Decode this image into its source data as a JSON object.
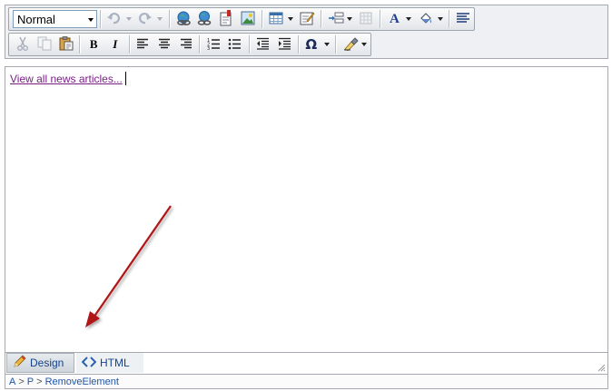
{
  "toolbar": {
    "format_select": {
      "value": "Normal"
    },
    "row1": [
      {
        "icon": "undo-icon",
        "state": "disabled",
        "split": true
      },
      {
        "icon": "redo-icon",
        "state": "disabled",
        "split": true
      },
      {
        "icon": "hyperlink-manager-icon"
      },
      {
        "icon": "remove-link-icon"
      },
      {
        "icon": "document-manager-icon"
      },
      {
        "icon": "image-manager-icon"
      },
      {
        "icon": "insert-table-icon",
        "split": true
      },
      {
        "icon": "edit-properties-icon"
      },
      {
        "icon": "insert-form-element-icon",
        "split": true
      },
      {
        "icon": "table-grid-icon",
        "state": "disabled"
      },
      {
        "icon": "foreground-color-icon",
        "split": true
      },
      {
        "icon": "background-color-icon",
        "split": true
      },
      {
        "icon": "paragraph-align-icon"
      }
    ],
    "row2": [
      {
        "icon": "cut-icon",
        "state": "disabled"
      },
      {
        "icon": "copy-icon",
        "state": "disabled"
      },
      {
        "icon": "paste-icon"
      },
      {
        "icon": "bold-icon",
        "glyph": "B"
      },
      {
        "icon": "italic-icon",
        "glyph": "I"
      },
      {
        "icon": "align-left-icon"
      },
      {
        "icon": "align-center-icon"
      },
      {
        "icon": "align-right-icon"
      },
      {
        "icon": "numbered-list-icon"
      },
      {
        "icon": "bulleted-list-icon"
      },
      {
        "icon": "outdent-icon"
      },
      {
        "icon": "indent-icon"
      },
      {
        "icon": "special-characters-icon",
        "glyph": "Ω",
        "split": true
      },
      {
        "icon": "format-stripper-icon",
        "split": true
      }
    ]
  },
  "content": {
    "link_text": "View all news articles..."
  },
  "modes": {
    "design_label": "Design",
    "html_label": "HTML",
    "active": "Design"
  },
  "status_bar": {
    "path": [
      "A",
      "P",
      "RemoveElement"
    ]
  },
  "colors": {
    "link": "#7a1f86",
    "annotation_arrow": "#b01217",
    "status_text": "#1e55a8"
  }
}
